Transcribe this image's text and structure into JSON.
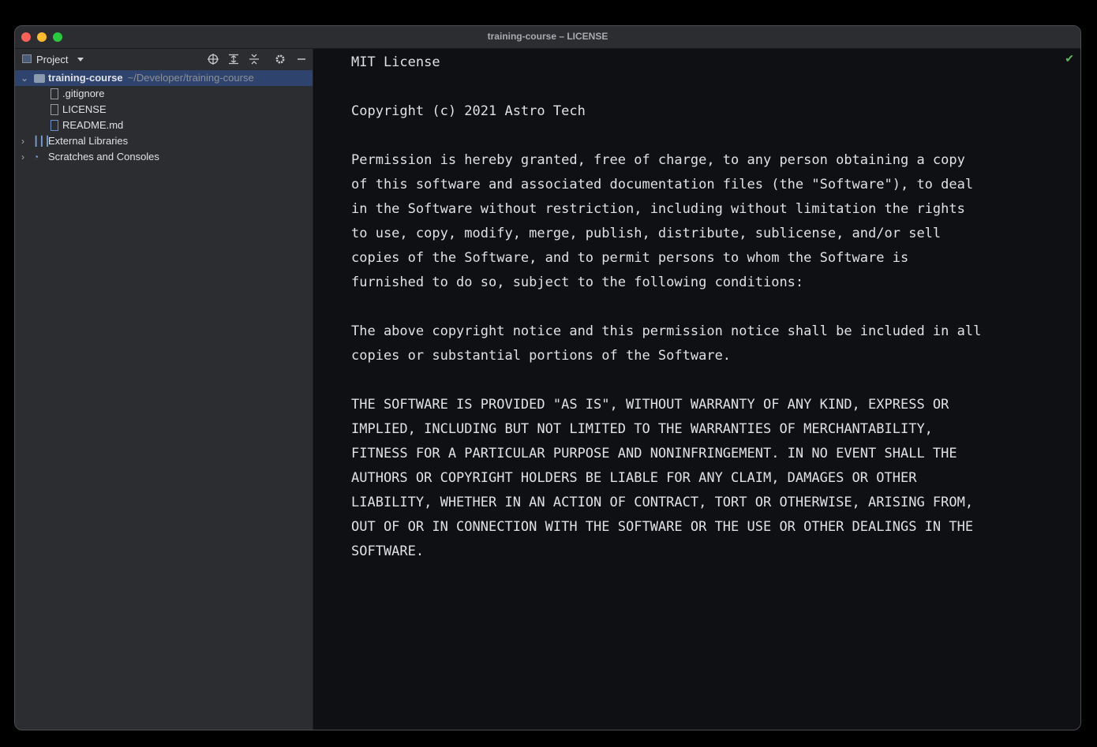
{
  "window": {
    "title": "training-course – LICENSE"
  },
  "sidebar": {
    "header_label": "Project",
    "toolbar_icons": [
      "locate-icon",
      "expand-all-icon",
      "collapse-all-icon",
      "gear-icon",
      "minimize-icon"
    ],
    "root": {
      "name": "training-course",
      "path": "~/Developer/training-course"
    },
    "files": [
      {
        "name": ".gitignore",
        "icon": "gitignore-file-icon"
      },
      {
        "name": "LICENSE",
        "icon": "text-file-icon"
      },
      {
        "name": "README.md",
        "icon": "markdown-file-icon"
      }
    ],
    "nodes": [
      {
        "name": "External Libraries",
        "icon": "library-icon"
      },
      {
        "name": "Scratches and Consoles",
        "icon": "scratches-icon"
      }
    ]
  },
  "editor": {
    "content": "MIT License\n\nCopyright (c) 2021 Astro Tech\n\nPermission is hereby granted, free of charge, to any person obtaining a copy\nof this software and associated documentation files (the \"Software\"), to deal\nin the Software without restriction, including without limitation the rights\nto use, copy, modify, merge, publish, distribute, sublicense, and/or sell\ncopies of the Software, and to permit persons to whom the Software is\nfurnished to do so, subject to the following conditions:\n\nThe above copyright notice and this permission notice shall be included in all\ncopies or substantial portions of the Software.\n\nTHE SOFTWARE IS PROVIDED \"AS IS\", WITHOUT WARRANTY OF ANY KIND, EXPRESS OR\nIMPLIED, INCLUDING BUT NOT LIMITED TO THE WARRANTIES OF MERCHANTABILITY,\nFITNESS FOR A PARTICULAR PURPOSE AND NONINFRINGEMENT. IN NO EVENT SHALL THE\nAUTHORS OR COPYRIGHT HOLDERS BE LIABLE FOR ANY CLAIM, DAMAGES OR OTHER\nLIABILITY, WHETHER IN AN ACTION OF CONTRACT, TORT OR OTHERWISE, ARISING FROM,\nOUT OF OR IN CONNECTION WITH THE SOFTWARE OR THE USE OR OTHER DEALINGS IN THE\nSOFTWARE.",
    "status_icon": "check-icon"
  },
  "colors": {
    "selection": "#2e436e",
    "editor_bg": "#0f1014",
    "sidebar_bg": "#2b2d30",
    "check": "#5fb85f"
  }
}
